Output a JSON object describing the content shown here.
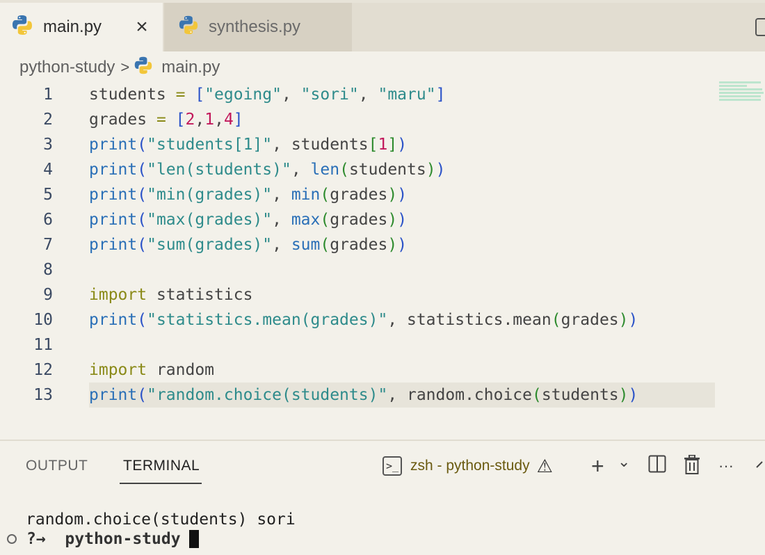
{
  "tabs": [
    {
      "label": "main.py",
      "active": true,
      "icon": "python-icon"
    },
    {
      "label": "synthesis.py",
      "active": false,
      "icon": "python-icon"
    }
  ],
  "close_symbol": "×",
  "breadcrumb": {
    "folder": "python-study",
    "separator": ">",
    "file": "main.py"
  },
  "code_lines": [
    {
      "n": "1"
    },
    {
      "n": "2"
    },
    {
      "n": "3"
    },
    {
      "n": "4"
    },
    {
      "n": "5"
    },
    {
      "n": "6"
    },
    {
      "n": "7"
    },
    {
      "n": "8"
    },
    {
      "n": "9"
    },
    {
      "n": "10"
    },
    {
      "n": "11"
    },
    {
      "n": "12"
    },
    {
      "n": "13"
    }
  ],
  "code": {
    "l1": {
      "a": "students",
      "b": " = ",
      "c": "[",
      "d": "\"egoing\"",
      "e": ", ",
      "f": "\"sori\"",
      "g": ", ",
      "h": "\"maru\"",
      "i": "]"
    },
    "l2": {
      "a": "grades",
      "b": " = ",
      "c": "[",
      "d": "2",
      "e": ",",
      "f": "1",
      "g": ",",
      "h": "4",
      "i": "]"
    },
    "l3": {
      "fn": "print",
      "o": "(",
      "s": "\"students[1]\"",
      "rest": ", students",
      "o2": "[",
      "idx": "1",
      "c2": "]",
      "c": ")"
    },
    "l4": {
      "fn": "print",
      "o": "(",
      "s": "\"len(students)\"",
      "rest": ", ",
      "fn2": "len",
      "o2": "(",
      "arg": "students",
      "c2": ")",
      "c": ")"
    },
    "l5": {
      "fn": "print",
      "o": "(",
      "s": "\"min(grades)\"",
      "rest": ", ",
      "fn2": "min",
      "o2": "(",
      "arg": "grades",
      "c2": ")",
      "c": ")"
    },
    "l6": {
      "fn": "print",
      "o": "(",
      "s": "\"max(grades)\"",
      "rest": ", ",
      "fn2": "max",
      "o2": "(",
      "arg": "grades",
      "c2": ")",
      "c": ")"
    },
    "l7": {
      "fn": "print",
      "o": "(",
      "s": "\"sum(grades)\"",
      "rest": ", ",
      "fn2": "sum",
      "o2": "(",
      "arg": "grades",
      "c2": ")",
      "c": ")"
    },
    "l9": {
      "kw": "import",
      "mod": " statistics"
    },
    "l10": {
      "fn": "print",
      "o": "(",
      "s": "\"statistics.mean(grades)\"",
      "rest": ", statistics.mean",
      "o2": "(",
      "arg": "grades",
      "c2": ")",
      "c": ")"
    },
    "l12": {
      "kw": "import",
      "mod": " random"
    },
    "l13": {
      "fn": "print",
      "o": "(",
      "s": "\"random.choice(students)\"",
      "rest": ", random.choice",
      "o2": "(",
      "arg": "students",
      "c2": ")",
      "c": ")"
    }
  },
  "panel": {
    "tabs": {
      "output": "OUTPUT",
      "terminal": "TERMINAL"
    },
    "terminal_name": "zsh - python-study",
    "terminal_icon_text": ">_",
    "warning_symbol": "⚠",
    "plus": "+",
    "chevron": "⌄",
    "more": "···",
    "output_line": "random.choice(students) sori",
    "prompt_marker": "?→",
    "prompt_dir": "python-study"
  },
  "colors": {
    "keyword": "#2a6fb7",
    "string": "#2e8b8b",
    "number": "#c2185b",
    "import": "#8a8a18",
    "terminal_name": "#6a5a10"
  }
}
